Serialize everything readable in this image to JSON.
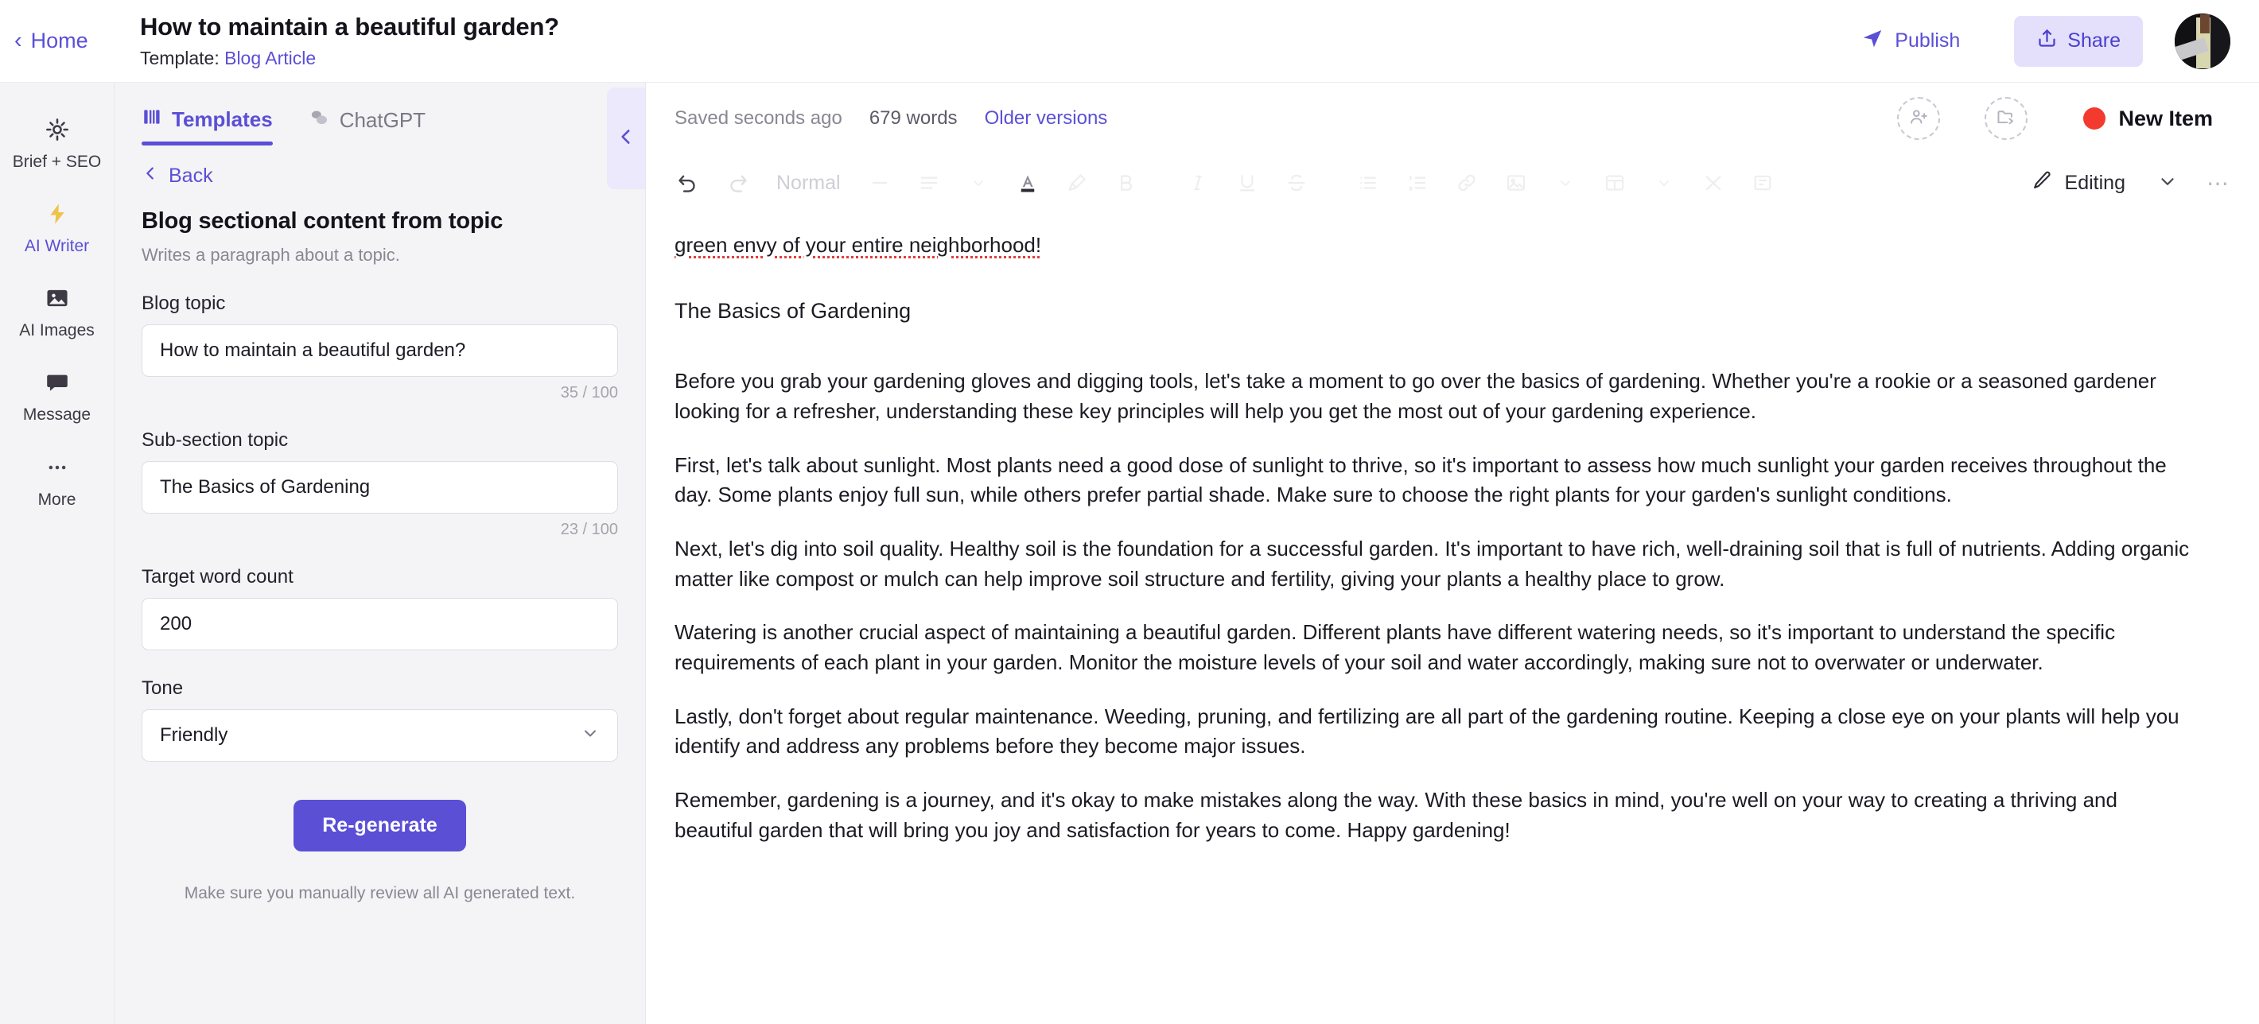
{
  "topbar": {
    "home_label": "Home",
    "doc_title": "How to maintain a beautiful garden?",
    "template_prefix": "Template:",
    "template_name": "Blog Article",
    "publish_label": "Publish",
    "share_label": "Share",
    "accent_color": "#5b4fd6",
    "share_bg": "#e4e0fb"
  },
  "rail": {
    "items": [
      {
        "label": "Brief + SEO",
        "icon": "target-icon",
        "active": false
      },
      {
        "label": "AI Writer",
        "icon": "lightning-icon",
        "active": true
      },
      {
        "label": "AI Images",
        "icon": "image-icon",
        "active": false
      },
      {
        "label": "Message",
        "icon": "chat-icon",
        "active": false
      },
      {
        "label": "More",
        "icon": "ellipsis-icon",
        "active": false
      }
    ]
  },
  "panel": {
    "tabs": [
      {
        "label": "Templates",
        "icon": "templates-grid-icon",
        "active": true
      },
      {
        "label": "ChatGPT",
        "icon": "chat-bubbles-icon",
        "active": false
      }
    ],
    "back_label": "Back",
    "template_title": "Blog sectional content from topic",
    "template_desc": "Writes a paragraph about a topic.",
    "fields": [
      {
        "label": "Blog topic",
        "value": "How to maintain a beautiful garden?",
        "placeholder": "Enter blog topic",
        "counter": "35 / 100"
      },
      {
        "label": "Sub-section topic",
        "value": "The Basics of Gardening",
        "placeholder": "Enter sub-section topic",
        "counter": "23 / 100"
      }
    ],
    "word_count_label": "Target word count",
    "word_count_value": "200",
    "word_count_placeholder": "200",
    "tone_label": "Tone",
    "tone_value": "Friendly",
    "regenerate_label": "Re-generate",
    "disclaimer": "Make sure you manually review all AI generated text."
  },
  "editor": {
    "saved_status": "Saved seconds ago",
    "word_count": "679 words",
    "older_versions": "Older versions",
    "new_item_label": "New Item",
    "new_item_dot_color": "#f23a2e",
    "editing_label": "Editing",
    "paragraph_style": "Normal",
    "toolbar_icons": [
      "undo-icon",
      "redo-icon",
      "align-left-icon",
      "line-height-icon",
      "text-color-icon",
      "highlighter-icon",
      "bold-icon",
      "italic-icon",
      "underline-icon",
      "strikethrough-icon",
      "bullet-list-icon",
      "numbered-list-icon",
      "link-icon",
      "image-insert-icon",
      "layout-icon",
      "clear-format-icon",
      "frame-icon"
    ],
    "document": {
      "spellchecked_line": "green envy of your entire neighborhood!",
      "heading": "The Basics of Gardening",
      "paragraphs": [
        "Before you grab your gardening gloves and digging tools, let's take a moment to go over the basics of gardening. Whether you're a rookie or a seasoned gardener looking for a refresher, understanding these key principles will help you get the most out of your gardening experience.",
        "First, let's talk about sunlight. Most plants need a good dose of sunlight to thrive, so it's important to assess how much sunlight your garden receives throughout the day. Some plants enjoy full sun, while others prefer partial shade. Make sure to choose the right plants for your garden's sunlight conditions.",
        "Next, let's dig into soil quality. Healthy soil is the foundation for a successful garden. It's important to have rich, well-draining soil that is full of nutrients. Adding organic matter like compost or mulch can help improve soil structure and fertility, giving your plants a healthy place to grow.",
        "Watering is another crucial aspect of maintaining a beautiful garden. Different plants have different watering needs, so it's important to understand the specific requirements of each plant in your garden. Monitor the moisture levels of your soil and water accordingly, making sure not to overwater or underwater.",
        "Lastly, don't forget about regular maintenance. Weeding, pruning, and fertilizing are all part of the gardening routine. Keeping a close eye on your plants will help you identify and address any problems before they become major issues.",
        "Remember, gardening is a journey, and it's okay to make mistakes along the way. With these basics in mind, you're well on your way to creating a thriving and beautiful garden that will bring you joy and satisfaction for years to come. Happy gardening!"
      ]
    }
  }
}
